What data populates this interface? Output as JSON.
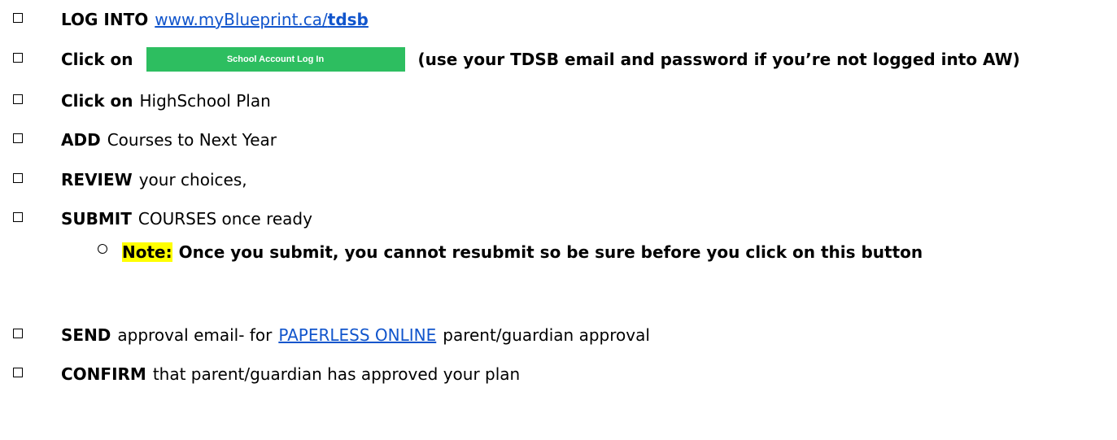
{
  "steps": [
    {
      "bold": "LOG INTO",
      "link_prefix": "www.myBlueprint.ca/",
      "link_bold": "tdsb"
    },
    {
      "bold": "Click on",
      "button_label": "School Account Log In",
      "note": "(use your TDSB email and password if you’re not logged into AW)"
    },
    {
      "bold": "Click on",
      "text": "HighSchool Plan"
    },
    {
      "bold": "ADD",
      "text": "Courses to Next Year"
    },
    {
      "bold": "REVIEW",
      "text": "your choices,"
    },
    {
      "bold": "SUBMIT",
      "text": "COURSES once ready"
    },
    {
      "bold": "SEND",
      "text": "approval email- for",
      "link": "PAPERLESS ONLINE",
      "text_after": "parent/guardian approval"
    },
    {
      "bold": "CONFIRM",
      "text": "that parent/guardian has approved your plan"
    }
  ],
  "submit_note": {
    "highlight": "Note:",
    "text": "Once you submit, you cannot resubmit so be sure before you click on this button"
  },
  "colors": {
    "link": "#1155cc",
    "button": "#2dbe60",
    "highlight": "#ffff00"
  }
}
